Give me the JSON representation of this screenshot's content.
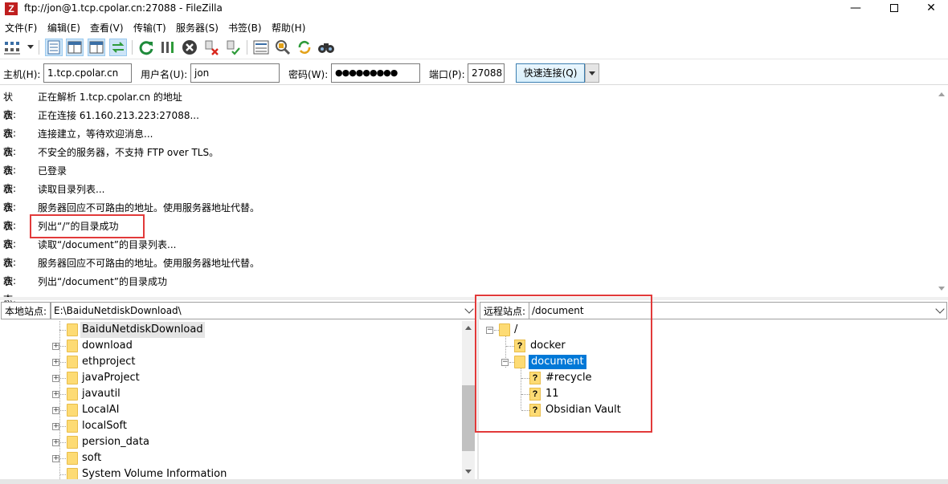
{
  "window": {
    "title": "ftp://jon@1.tcp.cpolar.cn:27088 - FileZilla",
    "app_icon_letter": "Z",
    "minimize_glyph": "—",
    "close_glyph": "✕"
  },
  "menu": {
    "items": [
      "文件(F)",
      "编辑(E)",
      "查看(V)",
      "传输(T)",
      "服务器(S)",
      "书签(B)",
      "帮助(H)"
    ]
  },
  "toolbar": {
    "icons": [
      "site-manager-icon",
      "toggle-log-icon",
      "toggle-local-tree-icon",
      "toggle-remote-tree-icon",
      "toggle-queue-icon",
      "refresh-icon",
      "process-queue-icon",
      "cancel-icon",
      "disconnect-icon",
      "reconnect-icon",
      "filter-icon",
      "compare-icon",
      "sync-browse-icon",
      "search-icon"
    ]
  },
  "quickconnect": {
    "host_label": "主机(H):",
    "host_value": "1.tcp.cpolar.cn",
    "user_label": "用户名(U):",
    "user_value": "jon",
    "pass_label": "密码(W):",
    "pass_value": "●●●●●●●●●",
    "port_label": "端口(P):",
    "port_value": "27088",
    "connect_label": "快速连接(Q)"
  },
  "log": {
    "status_label": "状态:",
    "messages": [
      "正在解析 1.tcp.cpolar.cn 的地址",
      "正在连接 61.160.213.223:27088...",
      "连接建立，等待欢迎消息...",
      "不安全的服务器，不支持 FTP over TLS。",
      "已登录",
      "读取目录列表...",
      "服务器回应不可路由的地址。使用服务器地址代替。",
      "列出“/”的目录成功",
      "读取“/document”的目录列表...",
      "服务器回应不可路由的地址。使用服务器地址代替。",
      "列出“/document”的目录成功"
    ]
  },
  "local": {
    "label": "本地站点:",
    "path": "E:\\BaiduNetdiskDownload\\",
    "tree": [
      "BaiduNetdiskDownload",
      "download",
      "ethproject",
      "javaProject",
      "javautil",
      "LocalAI",
      "localSoft",
      "persion_data",
      "soft",
      "System Volume Information"
    ]
  },
  "remote": {
    "label": "远程站点:",
    "path": "/document",
    "tree": [
      {
        "name": "/"
      },
      {
        "name": "docker"
      },
      {
        "name": "document",
        "selected": true
      },
      {
        "name": "#recycle"
      },
      {
        "name": "11"
      },
      {
        "name": "Obsidian Vault"
      }
    ],
    "unknown_glyph": "?"
  },
  "colors": {
    "selection": "#0078d7",
    "highlight_box": "#e23a3a",
    "folder": "#fddb74"
  }
}
